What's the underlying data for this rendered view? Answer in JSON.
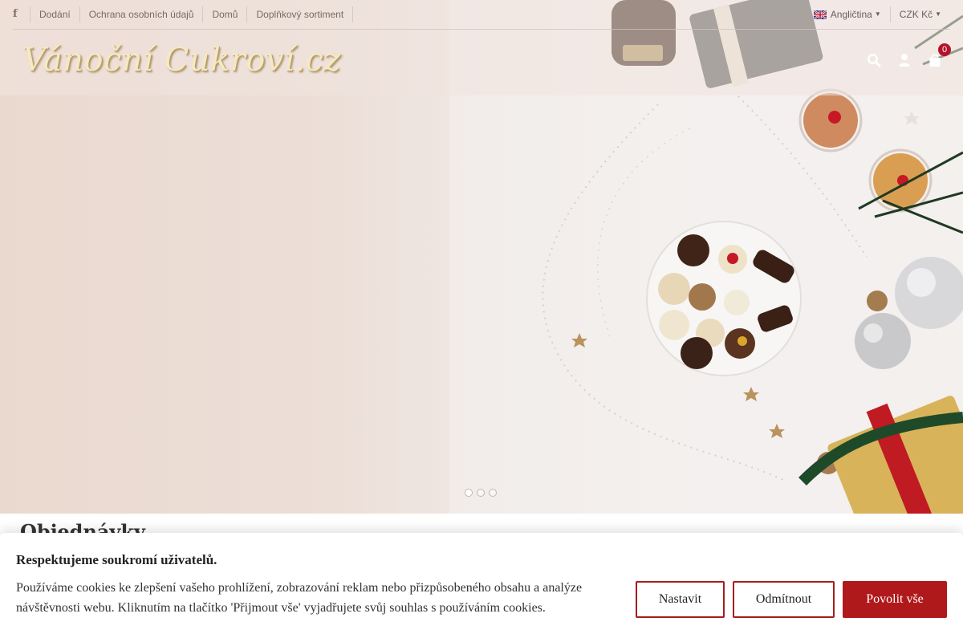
{
  "topbar": {
    "facebook_icon": "facebook-icon",
    "links": [
      "Dodání",
      "Ochrana osobních údajů",
      "Domů",
      "Doplňkový sortiment"
    ],
    "language": "Angličtina",
    "currency": "CZK Kč"
  },
  "header": {
    "logo_text": "Vánoční Cukroví.cz",
    "cart_count": "0",
    "icons": [
      "search-icon",
      "user-icon",
      "cart-icon"
    ]
  },
  "slider": {
    "dot_count": 3,
    "active_index": 0
  },
  "page": {
    "heading": "Objednávky"
  },
  "cookie": {
    "title": "Respektujeme soukromí uživatelů.",
    "text": "Používáme cookies ke zlepšení vašeho prohlížení, zobrazování reklam nebo přizpůsobeného obsahu a analýze návštěvnosti webu. Kliknutím na tlačítko 'Přijmout vše' vyjadřujete svůj souhlas s používáním cookies.",
    "settings_label": "Nastavit",
    "reject_label": "Odmítnout",
    "accept_label": "Povolit vše"
  },
  "colors": {
    "accent": "#b0191b",
    "badge": "#b5122a"
  }
}
